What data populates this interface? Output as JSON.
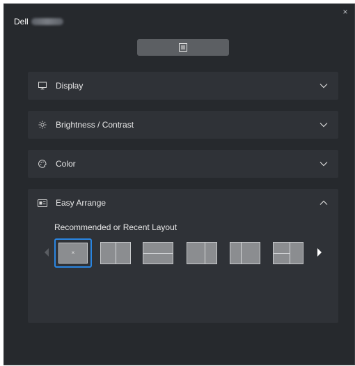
{
  "window": {
    "title": "Dell",
    "close_glyph": "×"
  },
  "toolbar": {
    "menu_icon": "list-icon"
  },
  "panels": [
    {
      "label": "Display",
      "icon": "monitor-icon",
      "expanded": false
    },
    {
      "label": "Brightness / Contrast",
      "icon": "sun-icon",
      "expanded": false
    },
    {
      "label": "Color",
      "icon": "palette-icon",
      "expanded": false
    },
    {
      "label": "Easy Arrange",
      "icon": "layout-icon",
      "expanded": true
    }
  ],
  "easy_arrange": {
    "section_label": "Recommended or Recent Layout",
    "selected_glyph": "×",
    "layouts": [
      {
        "name": "full",
        "selected": true
      },
      {
        "name": "two-columns",
        "selected": false
      },
      {
        "name": "two-rows",
        "selected": false
      },
      {
        "name": "two-columns-wide-left",
        "selected": false
      },
      {
        "name": "two-columns-wide-right",
        "selected": false
      },
      {
        "name": "three-split",
        "selected": false
      }
    ]
  },
  "colors": {
    "background": "#26292d",
    "panel": "#2f3237",
    "accent": "#2a86e2"
  }
}
